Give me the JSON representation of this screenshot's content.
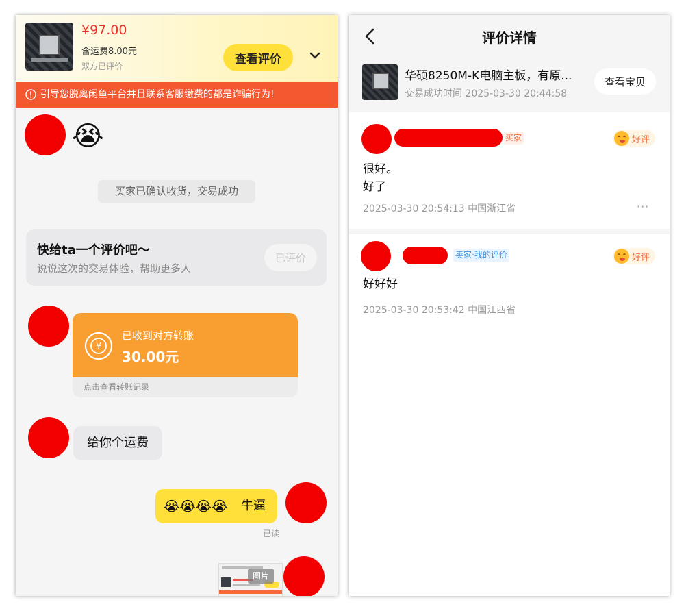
{
  "chat": {
    "order": {
      "price": "¥97.00",
      "shipping": "含运费8.00元",
      "review_status": "双方已评价",
      "view_review_button": "查看评价",
      "product_image_icon": "motherboard-thumbnail"
    },
    "warning": "引导您脱离闲鱼平台并且联系客服缴费的都是诈骗行为!",
    "messages": {
      "first_emoji": "😭",
      "system_notice": "买家已确认收货，交易成功",
      "rate_prompt": {
        "title": "快给ta一个评价吧～",
        "subtitle": "说说这次的交易体验，帮助更多人",
        "button": "已评价"
      },
      "transfer": {
        "label": "已收到对方转账",
        "amount": "30.00元",
        "link": "点击查看转账记录",
        "icon": "yen-circle-icon"
      },
      "text_left": "给你个运费",
      "text_right_emojis": "😭😭😭😭",
      "text_right": "牛逼",
      "read_status": "已读",
      "image_tag": "图片"
    }
  },
  "review": {
    "title": "评价详情",
    "product": {
      "title": "华硕8250M-K电脑主板，有原...",
      "time": "交易成功时间 2025-03-30 20:44:58",
      "view_button": "查看宝贝"
    },
    "items": [
      {
        "role": "买家",
        "rating": "好评",
        "text_lines": [
          "很好。",
          "好了"
        ],
        "meta": "2025-03-30 20:54:13  中国浙江省",
        "more": "···"
      },
      {
        "role": "卖家·我的评价",
        "rating": "好评",
        "text_lines": [
          "好好好"
        ],
        "meta": "2025-03-30 20:53:42  中国江西省"
      }
    ]
  },
  "colors": {
    "accent_yellow": "#ffe03a",
    "warning_red": "#f45830",
    "price_red": "#f0302c",
    "transfer_orange": "#f99e30",
    "redaction_red": "#f20000"
  }
}
